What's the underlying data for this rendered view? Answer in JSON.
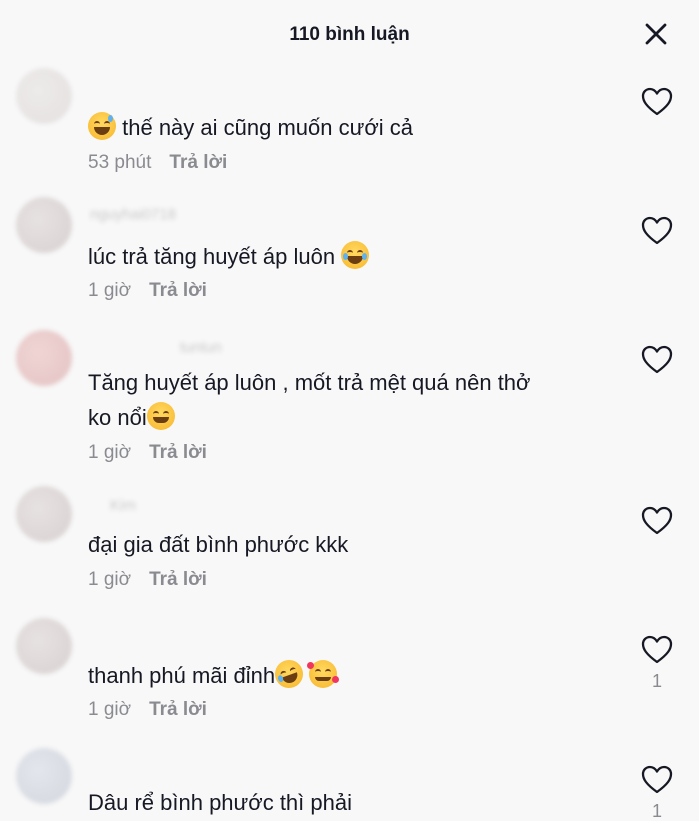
{
  "header": {
    "title": "110 bình luận",
    "close_icon": "close-icon"
  },
  "comments": [
    {
      "text": "thế này ai cũng muốn cưới cả",
      "leading_emoji": "grinning-sweat-emoji",
      "time": "53 phút",
      "reply": "Trả lời",
      "likes": ""
    },
    {
      "text": "lúc trả tăng huyết áp luôn",
      "trailing_emoji": "tears-of-joy-emoji",
      "time": "1 giờ",
      "reply": "Trả lời",
      "likes": ""
    },
    {
      "text_line1": "Tăng huyết áp luôn , mốt trả mệt quá nên thở",
      "text_line2": "ko nổi",
      "trailing_emoji": "grinning-emoji",
      "time": "1 giờ",
      "reply": "Trả lời",
      "likes": ""
    },
    {
      "text": "đại gia đất bình phước kkk",
      "time": "1 giờ",
      "reply": "Trả lời",
      "likes": ""
    },
    {
      "text": "thanh phú mãi đỉnh",
      "trailing_emoji": "rofl-emoji, smiling-face-with-hearts-emoji",
      "time": "1 giờ",
      "reply": "Trả lời",
      "likes": "1"
    },
    {
      "text": "Dâu rể bình phước thì phải",
      "likes": "1"
    }
  ]
}
